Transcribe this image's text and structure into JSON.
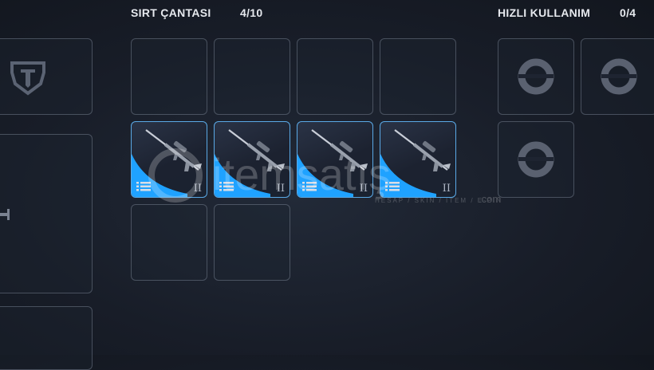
{
  "backpack": {
    "title": "SIRT ÇANTASI",
    "count": "4/10",
    "slots": [
      {
        "filled": false
      },
      {
        "filled": false
      },
      {
        "filled": false
      },
      {
        "filled": false
      },
      {
        "filled": true,
        "item_icon": "sniper-rifle-icon",
        "tier": "II"
      },
      {
        "filled": true,
        "item_icon": "sniper-rifle-icon",
        "tier": "II"
      },
      {
        "filled": true,
        "item_icon": "sniper-rifle-icon",
        "tier": "II"
      },
      {
        "filled": true,
        "item_icon": "sniper-rifle-icon",
        "tier": "II"
      },
      {
        "filled": false
      },
      {
        "filled": false
      }
    ]
  },
  "quick_use": {
    "title": "HIZLI KULLANIM",
    "count": "0/4",
    "slot_icon": "quick-slot-ring-icon"
  },
  "watermark": {
    "brand": "itemsatış",
    "tagline": "HESAP / SKIN / ITEM / E-PIN",
    "suffix": ".com"
  },
  "colors": {
    "accent": "#5aa9e6",
    "glow": "#1fa2ff",
    "slot_border": "#8f99ab"
  }
}
